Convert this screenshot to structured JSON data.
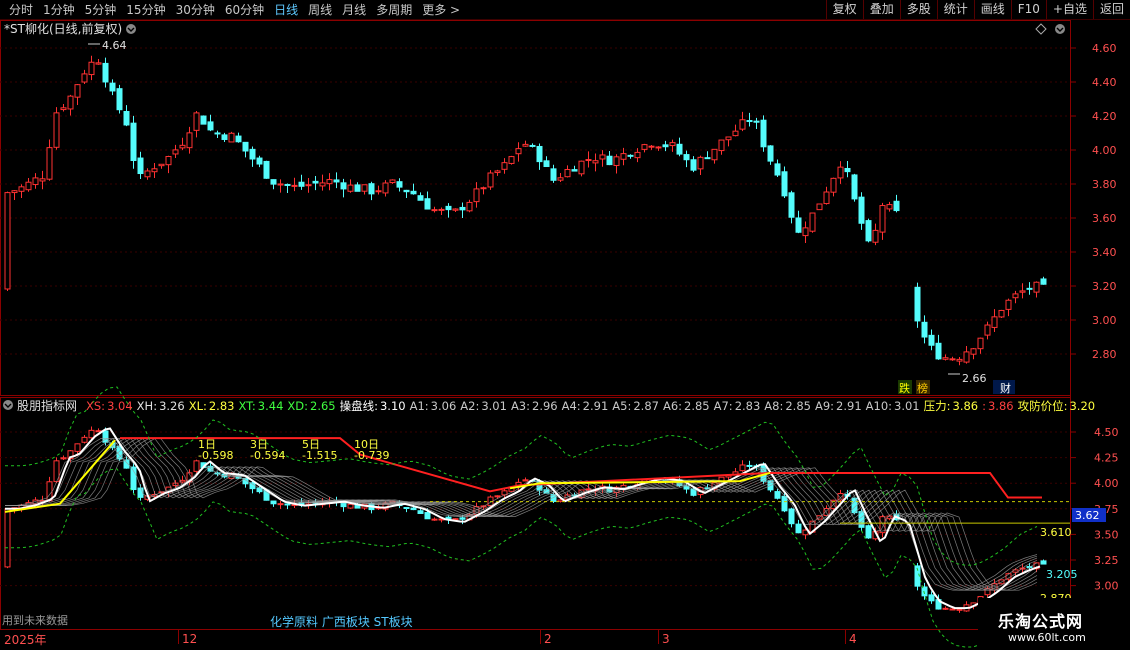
{
  "toolbar": {
    "tabs": [
      "分时",
      "1分钟",
      "5分钟",
      "15分钟",
      "30分钟",
      "60分钟",
      "日线",
      "周线",
      "月线",
      "多周期",
      "更多"
    ],
    "active_index": 6,
    "right_buttons": [
      "复权",
      "叠加",
      "多股",
      "统计",
      "画线",
      "F10",
      "+自选",
      "返回"
    ]
  },
  "main_panel": {
    "title": "*ST柳化(日线,前复权)",
    "high_label": "4.64",
    "low_label": "2.66",
    "badges": [
      "跌",
      "榜",
      "财"
    ],
    "price_ticks": [
      "4.60",
      "4.40",
      "4.20",
      "4.00",
      "3.80",
      "3.60",
      "3.40",
      "3.20",
      "3.00",
      "2.80"
    ]
  },
  "indicator_panel": {
    "name": "股朋指标网",
    "values": [
      {
        "label": "XS:",
        "value": "3.04",
        "color": "#ff4040"
      },
      {
        "label": "XH:",
        "value": "3.26",
        "color": "#e0e0e0"
      },
      {
        "label": "XL:",
        "value": "2.83",
        "color": "#ffff40"
      },
      {
        "label": "XT:",
        "value": "3.44",
        "color": "#40ff40"
      },
      {
        "label": "XD:",
        "value": "2.65",
        "color": "#40ff40"
      },
      {
        "label": "操盘线:",
        "value": "3.10",
        "color": "#ffffff"
      },
      {
        "label": "A1:",
        "value": "3.06",
        "color": "#c8c8c8"
      },
      {
        "label": "A2:",
        "value": "3.01",
        "color": "#c8c8c8"
      },
      {
        "label": "A3:",
        "value": "2.96",
        "color": "#c8c8c8"
      },
      {
        "label": "A4:",
        "value": "2.91",
        "color": "#c8c8c8"
      },
      {
        "label": "A5:",
        "value": "2.87",
        "color": "#c8c8c8"
      },
      {
        "label": "A6:",
        "value": "2.85",
        "color": "#c8c8c8"
      },
      {
        "label": "A7:",
        "value": "2.83",
        "color": "#c8c8c8"
      },
      {
        "label": "A8:",
        "value": "2.85",
        "color": "#c8c8c8"
      },
      {
        "label": "A9:",
        "value": "2.91",
        "color": "#c8c8c8"
      },
      {
        "label": "A10:",
        "value": "3.01",
        "color": "#c8c8c8"
      },
      {
        "label": "压力:",
        "value": "3.86",
        "color": "#ffff40"
      },
      {
        "label": ":",
        "value": "3.86",
        "color": "#ff4040"
      },
      {
        "label": "攻防价位:",
        "value": "3.20",
        "color": "#ffff40"
      }
    ],
    "period_labels": [
      {
        "name": "1日",
        "val": "-0.598"
      },
      {
        "name": "3日",
        "val": "-0.594"
      },
      {
        "name": "5日",
        "val": "-1.515"
      },
      {
        "name": "10日",
        "val": "-0.739"
      }
    ],
    "right_ticks": [
      "4.50",
      "4.25",
      "4.00",
      "3.75",
      "3.50",
      "3.25",
      "3.00"
    ],
    "current_price_tag": "3.62",
    "level_labels": [
      "3.610",
      "3.205",
      "2.870"
    ],
    "future_note": "用到未来数据",
    "sector_text": "化学原料 广西板块 ST板块"
  },
  "time_axis": [
    "2025年",
    "12",
    "2",
    "3",
    "4"
  ],
  "watermark": {
    "main": "乐淘公式网",
    "url": "www.60lt.com"
  },
  "colors": {
    "up": "#ff3232",
    "down": "#54fcfc",
    "grid": "#400000",
    "frame": "#8b0000"
  }
}
